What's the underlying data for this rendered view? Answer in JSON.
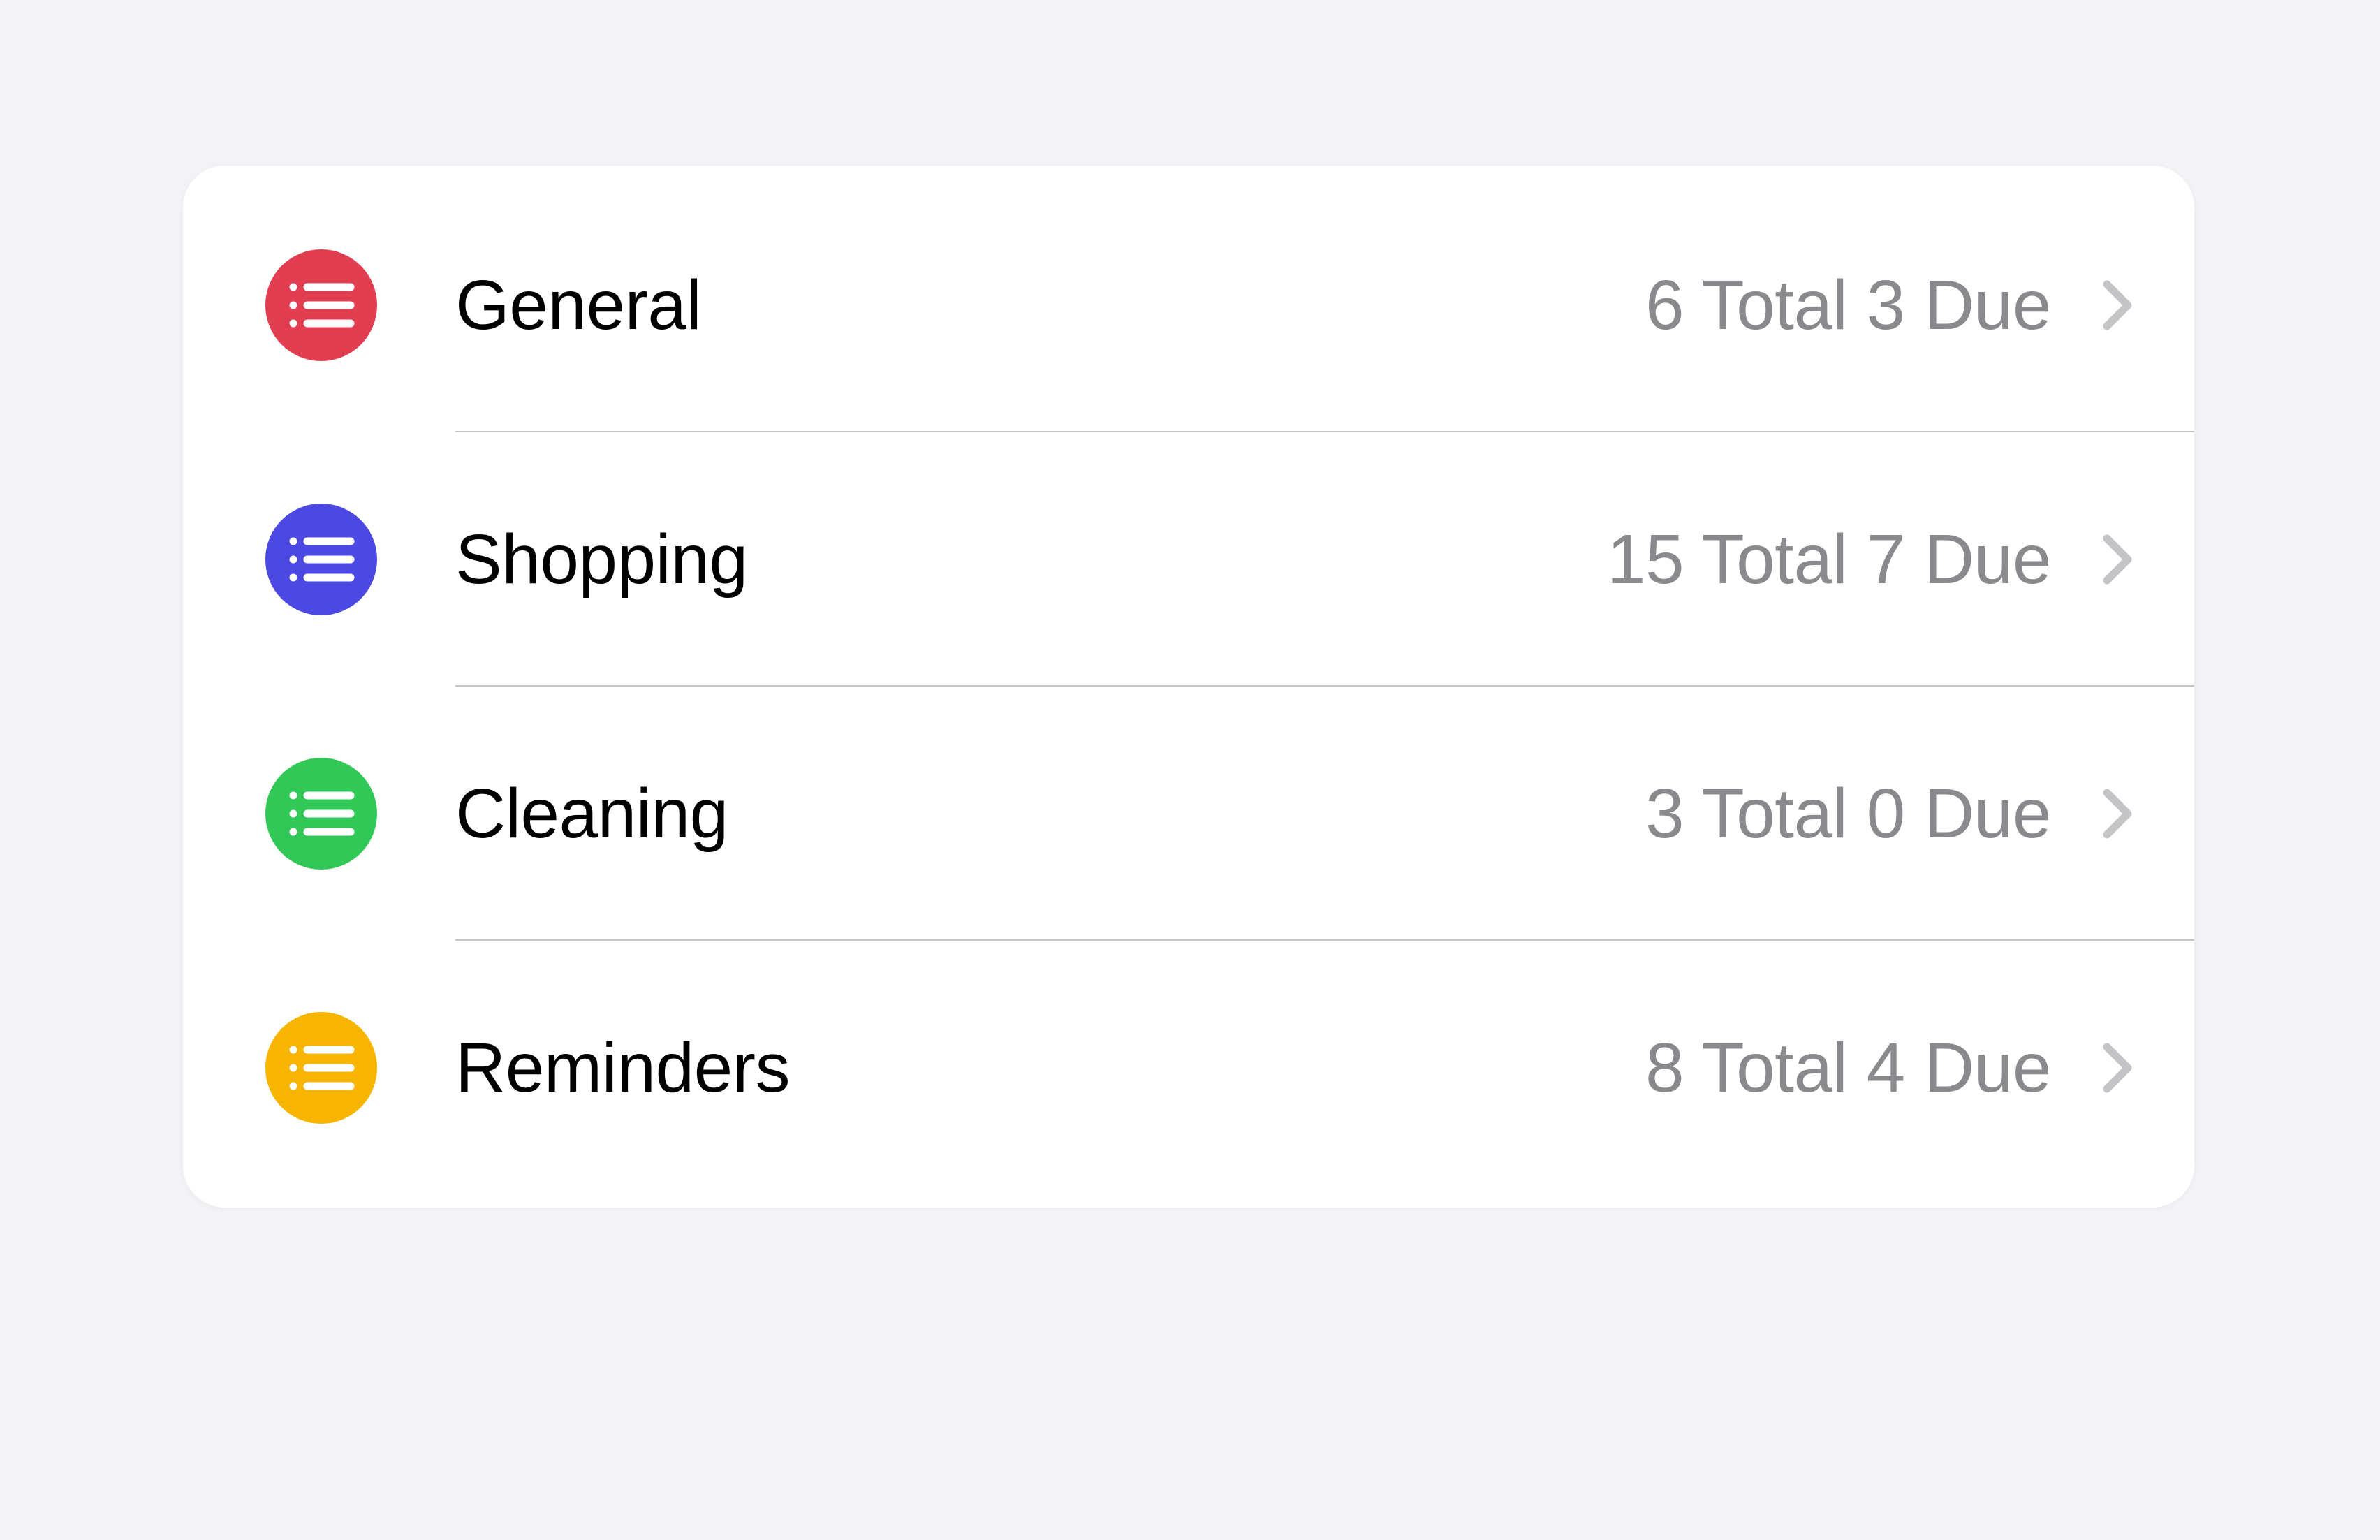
{
  "lists": [
    {
      "name": "General",
      "total": 6,
      "due": 3,
      "color": "#e23e52"
    },
    {
      "name": "Shopping",
      "total": 15,
      "due": 7,
      "color": "#4b49e1"
    },
    {
      "name": "Cleaning",
      "total": 3,
      "due": 0,
      "color": "#31c858"
    },
    {
      "name": "Reminders",
      "total": 8,
      "due": 4,
      "color": "#f7b500"
    }
  ]
}
